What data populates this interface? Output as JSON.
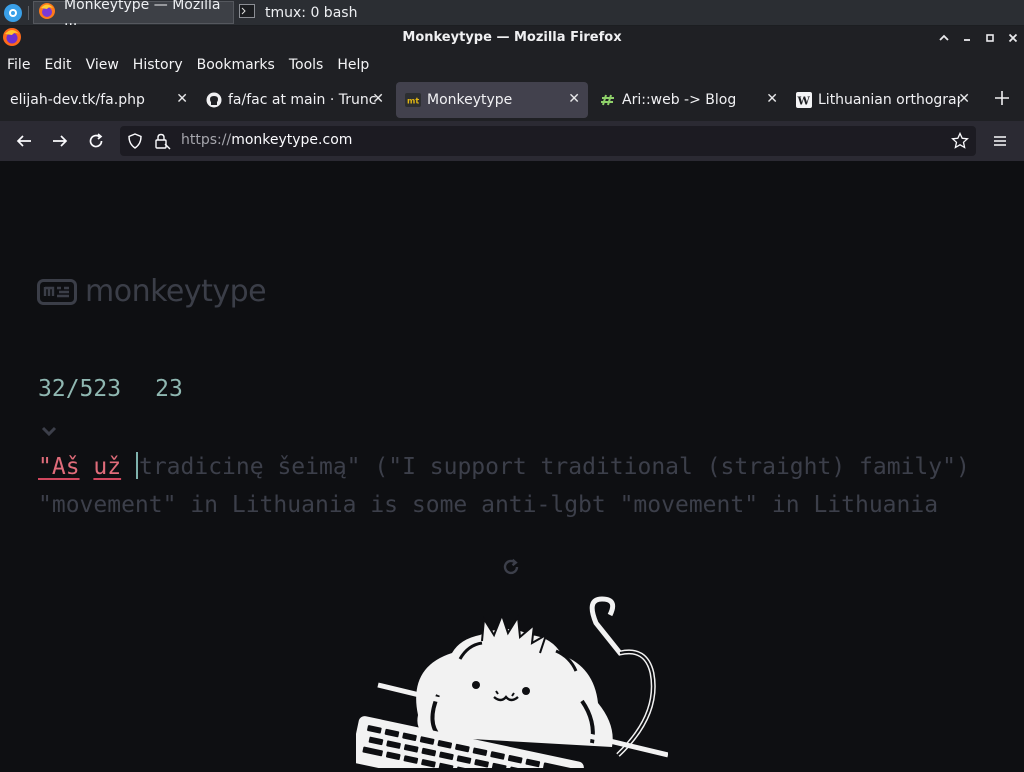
{
  "taskbar": {
    "firefox_task": "Monkeytype — Mozilla ...",
    "terminal_task": "tmux: 0 bash"
  },
  "window": {
    "title": "Monkeytype — Mozilla Firefox"
  },
  "menu": [
    "File",
    "Edit",
    "View",
    "History",
    "Bookmarks",
    "Tools",
    "Help"
  ],
  "tabs": [
    {
      "label": "elijah-dev.tk/fa.php",
      "icon": "page-icon",
      "active": false
    },
    {
      "label": "fa/fac at main · Trunc",
      "icon": "github-icon",
      "active": false
    },
    {
      "label": "Monkeytype",
      "icon": "monkeytype-icon",
      "active": true
    },
    {
      "label": "Ari::web -> Blog",
      "icon": "ari-web-icon",
      "active": false
    },
    {
      "label": "Lithuanian orthograp",
      "icon": "wikipedia-icon",
      "active": false
    }
  ],
  "nav": {
    "url_scheme": "https://",
    "url_host": "monkeytype.com"
  },
  "page": {
    "logo_text": "monkeytype",
    "progress": "32/523",
    "wpm": "23",
    "typed": {
      "word1": "\"Aš",
      "word2": "už"
    },
    "remaining_line1": "tradicinę šeimą\" (\"I support traditional (straight) family\")",
    "line2": "\"movement\" in Lithuania is some anti-lgbt \"movement\" in Lithuania"
  },
  "colors": {
    "background": "#0e0f12",
    "main_accent": "#8fb7b1",
    "error": "#e06c7a",
    "sub_text": "#3c3f4a"
  }
}
